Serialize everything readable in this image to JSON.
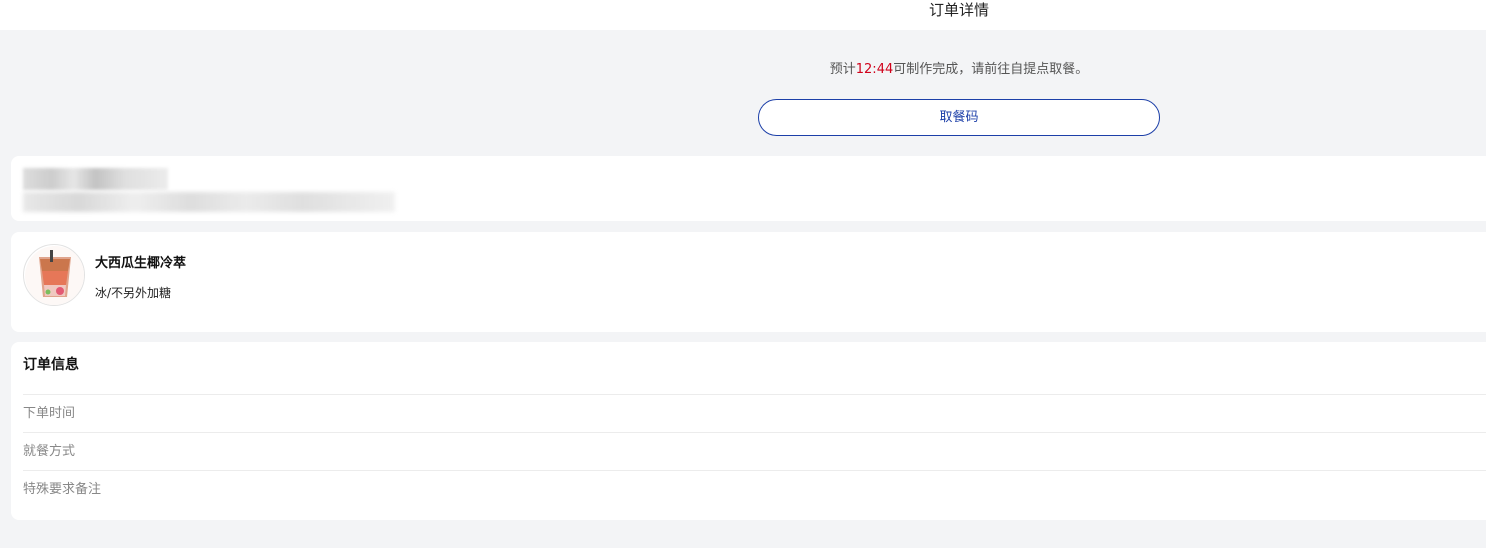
{
  "header": {
    "title": "订单详情"
  },
  "notice": {
    "prefix": "预计",
    "time": "12:44",
    "suffix": "可制作完成，请前往自提点取餐。"
  },
  "pickup_button": {
    "label": "取餐码"
  },
  "product": {
    "name": "大西瓜生椰冷萃",
    "spec": "冰/不另外加糖"
  },
  "order_info": {
    "title": "订单信息",
    "rows": [
      {
        "label": "下单时间"
      },
      {
        "label": "就餐方式"
      },
      {
        "label": "特殊要求备注"
      }
    ]
  },
  "colors": {
    "accent": "#1c3fa8",
    "time": "#d0021b",
    "background": "#f3f4f6"
  }
}
